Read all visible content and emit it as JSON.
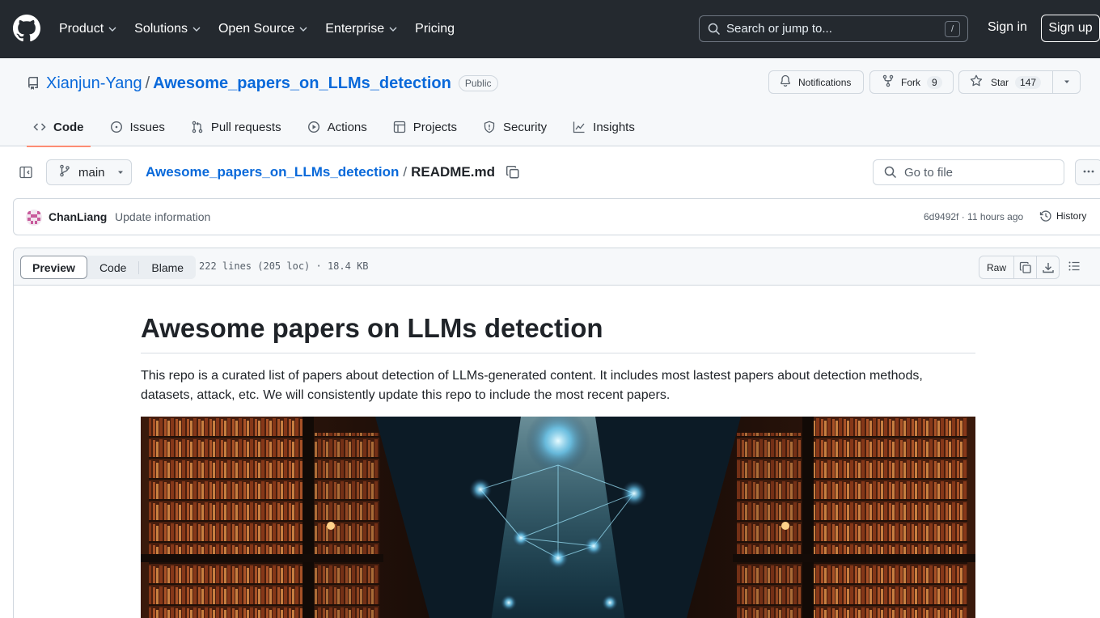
{
  "header": {
    "nav": [
      {
        "label": "Product",
        "dropdown": true
      },
      {
        "label": "Solutions",
        "dropdown": true
      },
      {
        "label": "Open Source",
        "dropdown": true
      },
      {
        "label": "Enterprise",
        "dropdown": true
      },
      {
        "label": "Pricing",
        "dropdown": false
      }
    ],
    "search_placeholder": "Search or jump to...",
    "search_shortcut": "/",
    "sign_in": "Sign in",
    "sign_up": "Sign up"
  },
  "repo": {
    "owner": "Xianjun-Yang",
    "separator": "/",
    "name": "Awesome_papers_on_LLMs_detection",
    "visibility": "Public",
    "notifications_label": "Notifications",
    "fork_label": "Fork",
    "fork_count": "9",
    "star_label": "Star",
    "star_count": "147",
    "tabs": [
      {
        "label": "Code",
        "icon": "code-icon",
        "active": true
      },
      {
        "label": "Issues",
        "icon": "issue-icon",
        "active": false
      },
      {
        "label": "Pull requests",
        "icon": "pull-request-icon",
        "active": false
      },
      {
        "label": "Actions",
        "icon": "play-icon",
        "active": false
      },
      {
        "label": "Projects",
        "icon": "table-icon",
        "active": false
      },
      {
        "label": "Security",
        "icon": "shield-icon",
        "active": false
      },
      {
        "label": "Insights",
        "icon": "graph-icon",
        "active": false
      }
    ]
  },
  "file": {
    "branch": "main",
    "breadcrumb_repo": "Awesome_papers_on_LLMs_detection",
    "breadcrumb_sep": "/",
    "filename": "README.md",
    "goto_placeholder": "Go to file"
  },
  "commit": {
    "author": "ChanLiang",
    "message": "Update information",
    "meta": "6d9492f · 11 hours ago",
    "history_label": "History"
  },
  "viewer": {
    "modes": [
      "Preview",
      "Code",
      "Blame"
    ],
    "active_mode": "Preview",
    "info": "222 lines (205 loc) · 18.4 KB",
    "raw_label": "Raw"
  },
  "readme": {
    "title": "Awesome papers on LLMs detection",
    "intro": "This repo is a curated list of papers about detection of LLMs-generated content. It includes most lastest papers about detection methods, datasets, attack, etc. We will consistently update this repo to include the most recent papers."
  },
  "colors": {
    "header_bg": "#24292f",
    "link": "#0969da",
    "active_tab_underline": "#fd8c73"
  }
}
